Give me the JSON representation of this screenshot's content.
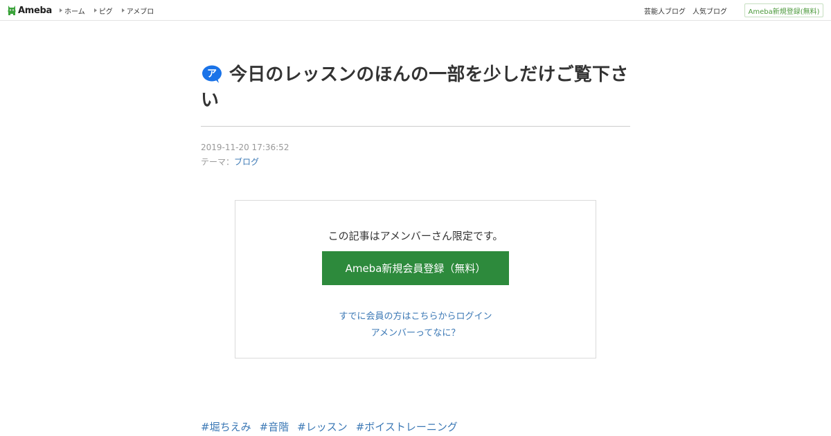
{
  "header": {
    "logo_text": "Ameba",
    "nav": [
      {
        "label": "ホーム"
      },
      {
        "label": "ピグ"
      },
      {
        "label": "アメブロ"
      }
    ],
    "right_links": [
      {
        "label": "芸能人ブログ"
      },
      {
        "label": "人気ブログ"
      }
    ],
    "signup_label": "Ameba新規登録(無料)"
  },
  "article": {
    "member_icon_letter": "ア",
    "title": "今日のレッスンのほんの一部を少しだけご覧下さい",
    "datetime": "2019-11-20 17:36:52",
    "theme_prefix": "テーマ：",
    "theme": "ブログ"
  },
  "member_box": {
    "message": "この記事はアメンバーさん限定です。",
    "register_label": "Ameba新規会員登録（無料）",
    "login_label": "すでに会員の方はこちらからログイン",
    "what_label": "アメンバーってなに？"
  },
  "hashtags": [
    "#堀ちえみ",
    "#音階",
    "#レッスン",
    "#ボイストレーニング"
  ],
  "colors": {
    "link": "#3b78b5",
    "register_button": "#2d8a3c",
    "signup_border": "#c6dfc0",
    "signup_text": "#4c9a3c",
    "member_icon": "#1a73e8"
  }
}
